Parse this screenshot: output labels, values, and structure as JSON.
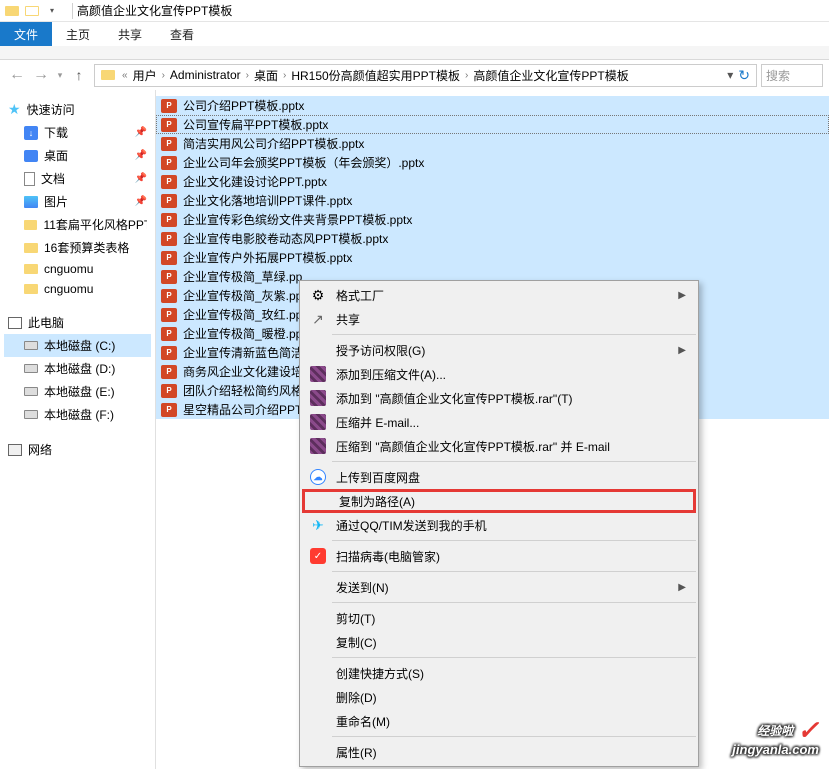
{
  "window": {
    "title": "高颜值企业文化宣传PPT模板"
  },
  "ribbon": {
    "tabs": [
      "文件",
      "主页",
      "共享",
      "查看"
    ]
  },
  "breadcrumb": {
    "prefix": "«",
    "parts": [
      "用户",
      "Administrator",
      "桌面",
      "HR150份高颜值超实用PPT模板",
      "高颜值企业文化宣传PPT模板"
    ]
  },
  "search": {
    "placeholder": "搜索"
  },
  "sidebar": {
    "quick": {
      "label": "快速访问",
      "items": [
        {
          "label": "下载",
          "pinned": true
        },
        {
          "label": "桌面",
          "pinned": true
        },
        {
          "label": "文档",
          "pinned": true
        },
        {
          "label": "图片",
          "pinned": true
        },
        {
          "label": "11套扁平化风格PPT"
        },
        {
          "label": "16套预算类表格"
        },
        {
          "label": "cnguomu"
        },
        {
          "label": "cnguomu"
        }
      ]
    },
    "pc": {
      "label": "此电脑",
      "drives": [
        {
          "label": "本地磁盘 (C:)",
          "selected": true
        },
        {
          "label": "本地磁盘 (D:)"
        },
        {
          "label": "本地磁盘 (E:)"
        },
        {
          "label": "本地磁盘 (F:)"
        }
      ]
    },
    "network": {
      "label": "网络"
    }
  },
  "files": [
    {
      "name": "公司介绍PPT模板.pptx",
      "sel": true
    },
    {
      "name": "公司宣传扁平PPT模板.pptx",
      "sel": true,
      "focused": true
    },
    {
      "name": "简洁实用风公司介绍PPT模板.pptx",
      "sel": true
    },
    {
      "name": "企业公司年会颁奖PPT模板（年会颁奖）.pptx",
      "sel": true
    },
    {
      "name": "企业文化建设讨论PPT.pptx",
      "sel": true
    },
    {
      "name": "企业文化落地培训PPT课件.pptx",
      "sel": true
    },
    {
      "name": "企业宣传彩色缤纷文件夹背景PPT模板.pptx",
      "sel": true
    },
    {
      "name": "企业宣传电影胶卷动态风PPT模板.pptx",
      "sel": true
    },
    {
      "name": "企业宣传户外拓展PPT模板.pptx",
      "sel": true
    },
    {
      "name": "企业宣传极简_草绿.pp",
      "sel": true,
      "cut": true
    },
    {
      "name": "企业宣传极简_灰紫.pp",
      "sel": true,
      "cut": true
    },
    {
      "name": "企业宣传极简_玫红.pp",
      "sel": true,
      "cut": true
    },
    {
      "name": "企业宣传极简_暖橙.pp",
      "sel": true,
      "cut": true
    },
    {
      "name": "企业宣传清新蓝色简洁",
      "sel": true,
      "cut": true
    },
    {
      "name": "商务风企业文化建设培",
      "sel": true,
      "cut": true
    },
    {
      "name": "团队介绍轻松简约风格",
      "sel": true,
      "cut": true
    },
    {
      "name": "星空精品公司介绍PPT",
      "sel": true,
      "cut": true
    }
  ],
  "context_menu": {
    "items": [
      {
        "icon": "fgf",
        "label": "格式工厂",
        "arrow": true
      },
      {
        "icon": "share",
        "label": "共享"
      },
      {
        "sep": true
      },
      {
        "label": "授予访问权限(G)",
        "arrow": true
      },
      {
        "icon": "rar",
        "label": "添加到压缩文件(A)..."
      },
      {
        "icon": "rar",
        "label": "添加到 \"高颜值企业文化宣传PPT模板.rar\"(T)"
      },
      {
        "icon": "rar",
        "label": "压缩并 E-mail..."
      },
      {
        "icon": "rar",
        "label": "压缩到 \"高颜值企业文化宣传PPT模板.rar\" 并 E-mail"
      },
      {
        "sep": true
      },
      {
        "icon": "baidu",
        "label": "上传到百度网盘"
      },
      {
        "label": "复制为路径(A)",
        "highlight": true
      },
      {
        "icon": "qq",
        "label": "通过QQ/TIM发送到我的手机"
      },
      {
        "sep": true
      },
      {
        "icon": "shield",
        "label": "扫描病毒(电脑管家)"
      },
      {
        "sep": true
      },
      {
        "label": "发送到(N)",
        "arrow": true
      },
      {
        "sep": true
      },
      {
        "label": "剪切(T)"
      },
      {
        "label": "复制(C)"
      },
      {
        "sep": true
      },
      {
        "label": "创建快捷方式(S)"
      },
      {
        "label": "删除(D)"
      },
      {
        "label": "重命名(M)"
      },
      {
        "sep": true
      },
      {
        "label": "属性(R)"
      }
    ]
  },
  "watermark": {
    "top": "经验啦",
    "bottom": "jingyanla.com"
  }
}
